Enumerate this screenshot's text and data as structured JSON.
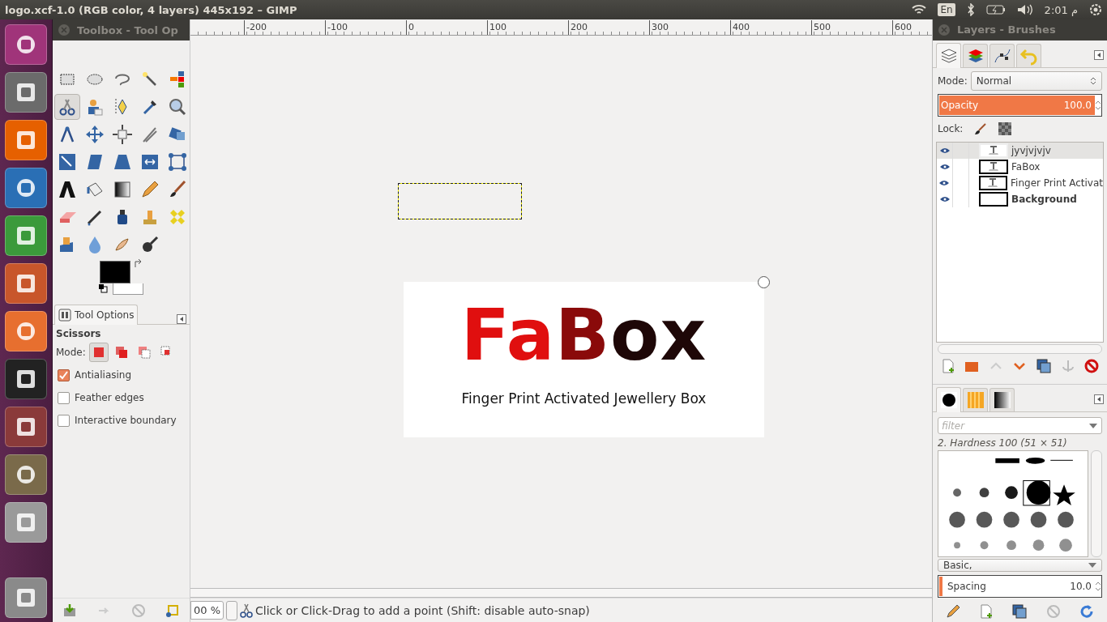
{
  "top_bar": {
    "title": "logo.xcf-1.0 (RGB color, 4 layers) 445x192 – GIMP",
    "keyboard": "En",
    "clock": "م 2:01"
  },
  "toolbox": {
    "title": "Toolbox - Tool Op",
    "tools": [
      {
        "selected": false
      },
      {
        "selected": false
      },
      {
        "selected": false
      },
      {
        "selected": false
      },
      {
        "selected": false
      },
      {
        "selected": true
      },
      {
        "selected": false
      },
      {
        "selected": false
      },
      {
        "selected": false
      },
      {
        "selected": false
      },
      {
        "selected": false
      },
      {
        "selected": false
      },
      {
        "selected": false
      },
      {
        "selected": false
      },
      {
        "selected": false
      },
      {
        "selected": false
      },
      {
        "selected": false
      },
      {
        "selected": false
      },
      {
        "selected": false
      },
      {
        "selected": false
      },
      {
        "selected": false
      },
      {
        "selected": false
      },
      {
        "selected": false
      },
      {
        "selected": false
      },
      {
        "selected": false
      },
      {
        "selected": false
      },
      {
        "selected": false
      },
      {
        "selected": false
      },
      {
        "selected": false
      },
      {
        "selected": false
      },
      {
        "selected": false
      },
      {
        "selected": false
      },
      {
        "selected": false
      },
      {
        "selected": false
      }
    ],
    "options_tab": "Tool Options",
    "tool_name": "Scissors",
    "mode_label": "Mode:",
    "modes": [
      {
        "selected": true
      },
      {
        "selected": false
      },
      {
        "selected": false
      },
      {
        "selected": false
      }
    ],
    "options": [
      {
        "label": "Antialiasing",
        "checked": true
      },
      {
        "label": "Feather edges",
        "checked": false
      },
      {
        "label": "Interactive boundary",
        "checked": false
      }
    ]
  },
  "ruler": {
    "ticks": [
      "-200",
      "-100",
      "0",
      "100",
      "200",
      "300",
      "400",
      "500",
      "600"
    ]
  },
  "image": {
    "logo_parts": [
      {
        "text": "Fa",
        "color": "#e00f0f"
      },
      {
        "text": "B",
        "color": "#8a0a0a"
      },
      {
        "text": "ox",
        "color": "#1e0707"
      }
    ],
    "subtitle": "Finger Print Activated Jewellery Box"
  },
  "status_bar": {
    "zoom": "00 %",
    "message": "Click or Click-Drag to add a point (Shift: disable auto-snap)"
  },
  "dock": {
    "title": "Layers - Brushes",
    "tabs": [
      {
        "selected": true
      },
      {
        "selected": false
      },
      {
        "selected": false
      },
      {
        "selected": false
      }
    ],
    "mode_label": "Mode:",
    "mode": "Normal",
    "opacity": {
      "label": "Opacity",
      "value": "100.0",
      "level": 1.0
    },
    "lock_label": "Lock:",
    "layers": [
      {
        "name": "jyvjvjvjv",
        "selected": true,
        "visible": true,
        "bold": false
      },
      {
        "name": "FaBox",
        "selected": false,
        "visible": true,
        "bold": false
      },
      {
        "name": "Finger Print Activat",
        "selected": false,
        "visible": true,
        "bold": false
      },
      {
        "name": "Background",
        "selected": false,
        "visible": true,
        "bold": true
      }
    ],
    "brush_tabs": [
      {
        "selected": true
      },
      {
        "selected": false
      },
      {
        "selected": false
      }
    ],
    "filter": {
      "placeholder": "filter"
    },
    "brush_name": "2. Hardness 100 (51 × 51)",
    "brush_set": "Basic,",
    "spacing": {
      "label": "Spacing",
      "value": "10.0",
      "level": 0.02
    }
  }
}
